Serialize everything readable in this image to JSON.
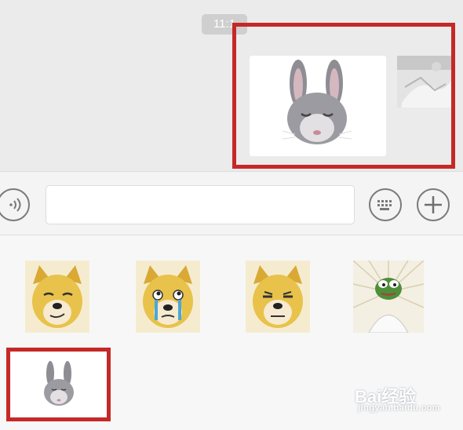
{
  "chat": {
    "time_label": "11:1",
    "messages": [
      {
        "type": "image",
        "sticker": "rabbit-sticker"
      },
      {
        "type": "image",
        "sticker": "photo-thumbnail"
      }
    ]
  },
  "input_bar": {
    "voice_icon": "voice-icon",
    "emoji_icon": "keyboard-icon",
    "more_icon": "plus-icon",
    "text_value": ""
  },
  "sticker_panel": {
    "stickers": [
      {
        "icon": "doge-smirk-sticker"
      },
      {
        "icon": "doge-crying-sticker"
      },
      {
        "icon": "doge-tired-sticker"
      },
      {
        "icon": "pepe-frog-sticker"
      },
      {
        "icon": "rabbit-sticker"
      }
    ]
  },
  "watermark": {
    "logo": "Bai经验",
    "sub": "jingyan.baidu.com"
  },
  "colors": {
    "highlight_box": "#c62828",
    "doge_yellow": "#e8c24a",
    "frog_green": "#4e8f3a"
  }
}
